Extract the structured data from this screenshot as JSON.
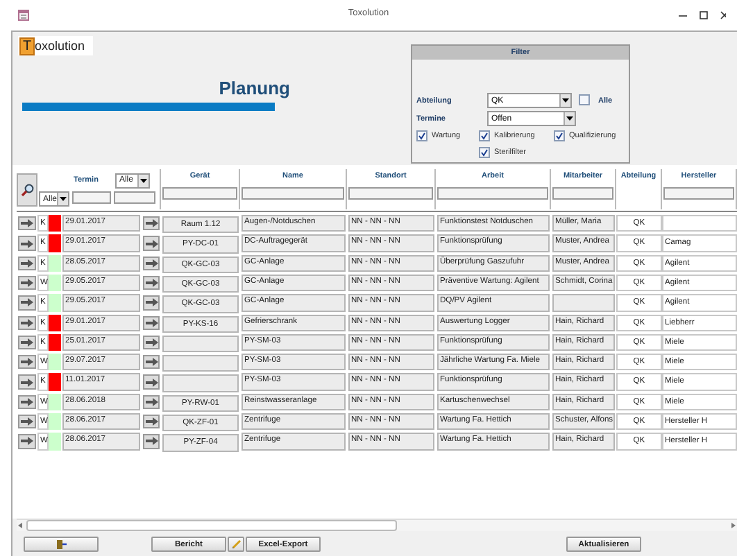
{
  "window": {
    "title": "Toxolution"
  },
  "logo": {
    "initial": "T",
    "text": "oxolution"
  },
  "heading": "Planung",
  "filter": {
    "title": "Filter",
    "abteilung": {
      "label": "Abteilung",
      "value": "QK"
    },
    "alle": {
      "label": "Alle",
      "checked": false
    },
    "termine": {
      "label": "Termine",
      "value": "Offen"
    },
    "types": [
      {
        "label": "Wartung",
        "checked": true
      },
      {
        "label": "Kalibrierung",
        "checked": true
      },
      {
        "label": "Qualifizierung",
        "checked": true
      },
      {
        "label": "Sterilfilter",
        "checked": true
      }
    ]
  },
  "table": {
    "termin_header": "Termin",
    "termin_filter": "Alle",
    "type_filter": "Alle",
    "columns": [
      "Gerät",
      "Name",
      "Standort",
      "Arbeit",
      "Mitarbeiter",
      "Abteilung",
      "Hersteller"
    ],
    "rows": [
      {
        "typ": "K",
        "color": "#ff0000",
        "termin": "29.01.2017",
        "geraet": "Raum 1.12",
        "name": "Augen-/Notduschen",
        "standort": "NN - NN - NN",
        "arbeit": "Funktionstest Notduschen",
        "mitarbeiter": "Müller, Maria",
        "abteilung": "QK"
      },
      {
        "typ": "K",
        "color": "#ff0000",
        "termin": "29.01.2017",
        "geraet": "PY-DC-01",
        "name": "DC-Auftragegerät",
        "standort": "NN - NN - NN",
        "arbeit": "Funktionsprüfung",
        "mitarbeiter": "Muster, Andrea",
        "abteilung": "QK",
        "hersteller": "Camag"
      },
      {
        "typ": "K",
        "color": "#ccffcc",
        "termin": "28.05.2017",
        "geraet": "QK-GC-03",
        "name": "GC-Anlage",
        "standort": "NN - NN - NN",
        "arbeit": "Überprüfung Gaszufuhr",
        "mitarbeiter": "Muster, Andrea",
        "abteilung": "QK",
        "hersteller": "Agilent"
      },
      {
        "typ": "W",
        "color": "#ccffcc",
        "termin": "29.05.2017",
        "geraet": "QK-GC-03",
        "name": "GC-Anlage",
        "standort": "NN - NN - NN",
        "arbeit": "Präventive Wartung: Agilent",
        "mitarbeiter": "Schmidt, Corina",
        "abteilung": "QK",
        "hersteller": "Agilent"
      },
      {
        "typ": "K",
        "color": "#ccffcc",
        "termin": "29.05.2017",
        "geraet": "QK-GC-03",
        "name": "GC-Anlage",
        "standort": "NN - NN - NN",
        "arbeit": "DQ/PV Agilent",
        "abteilung": "QK",
        "hersteller": "Agilent"
      },
      {
        "typ": "K",
        "color": "#ff0000",
        "termin": "29.01.2017",
        "geraet": "PY-KS-16",
        "name": "Gefrierschrank",
        "standort": "NN - NN - NN",
        "arbeit": "Auswertung Logger",
        "mitarbeiter": "Hain, Richard",
        "abteilung": "QK",
        "hersteller": "Liebherr"
      },
      {
        "typ": "K",
        "color": "#ff0000",
        "termin": "25.01.2017",
        "name": "PY-SM-03",
        "standort": "NN - NN - NN",
        "arbeit": "Funktionsprüfung",
        "mitarbeiter": "Hain, Richard",
        "abteilung": "QK",
        "hersteller": "Miele"
      },
      {
        "typ": "W",
        "color": "#ccffcc",
        "termin": "29.07.2017",
        "name": "PY-SM-03",
        "standort": "NN - NN - NN",
        "arbeit": "Jährliche Wartung Fa. Miele",
        "mitarbeiter": "Hain, Richard",
        "abteilung": "QK",
        "hersteller": "Miele"
      },
      {
        "typ": "K",
        "color": "#ff0000",
        "termin": "11.01.2017",
        "name": "PY-SM-03",
        "standort": "NN - NN - NN",
        "arbeit": "Funktionsprüfung",
        "mitarbeiter": "Hain, Richard",
        "abteilung": "QK",
        "hersteller": "Miele"
      },
      {
        "typ": "W",
        "color": "#ccffcc",
        "termin": "28.06.2018",
        "geraet": "PY-RW-01",
        "name": "Reinstwasseranlage",
        "standort": "NN - NN - NN",
        "arbeit": "Kartuschenwechsel",
        "mitarbeiter": "Hain, Richard",
        "abteilung": "QK",
        "hersteller": "Miele"
      },
      {
        "typ": "W",
        "color": "#ccffcc",
        "termin": "28.06.2017",
        "geraet": "QK-ZF-01",
        "name": "Zentrifuge",
        "standort": "NN - NN - NN",
        "arbeit": "Wartung Fa. Hettich",
        "mitarbeiter": "Schuster, Alfons",
        "abteilung": "QK",
        "hersteller": "Hersteller H"
      },
      {
        "typ": "W",
        "color": "#ccffcc",
        "termin": "28.06.2017",
        "geraet": "PY-ZF-04",
        "name": "Zentrifuge",
        "standort": "NN - NN - NN",
        "arbeit": "Wartung Fa. Hettich",
        "mitarbeiter": "Hain, Richard",
        "abteilung": "QK",
        "hersteller": "Hersteller H"
      }
    ]
  },
  "buttons": {
    "bericht": "Bericht",
    "export": "Excel-Export",
    "refresh": "Aktualisieren"
  }
}
